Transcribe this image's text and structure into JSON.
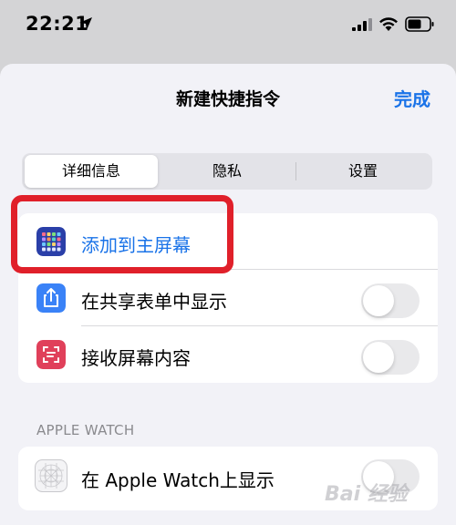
{
  "status_bar": {
    "time": "22:21",
    "icons": [
      "location-arrow-icon",
      "signal-icon",
      "wifi-icon",
      "battery-icon"
    ]
  },
  "nav": {
    "title": "新建快捷指令",
    "done_label": "完成"
  },
  "segments": [
    {
      "label": "详细信息",
      "selected": true
    },
    {
      "label": "隐私",
      "selected": false
    },
    {
      "label": "设置",
      "selected": false
    }
  ],
  "details_group": {
    "rows": [
      {
        "label": "添加到主屏幕",
        "icon": "home-screen-grid-icon",
        "has_toggle": false,
        "highlighted": true
      },
      {
        "label": "在共享表单中显示",
        "icon": "share-icon",
        "has_toggle": true,
        "toggle_on": false
      },
      {
        "label": "接收屏幕内容",
        "icon": "screen-capture-icon",
        "has_toggle": true,
        "toggle_on": false
      }
    ]
  },
  "watch_section": {
    "header": "APPLE WATCH",
    "row": {
      "label": "在 Apple Watch上显示",
      "icon": "apple-watch-grid-icon",
      "has_toggle": true,
      "toggle_on": false
    }
  },
  "colors": {
    "accent": "#1a73e8",
    "highlight_border": "#e0202a",
    "share_icon_bg": "#3a82f7",
    "screen_icon_bg": "#e0405a",
    "home_icon_bg": "#2a3fa8"
  },
  "watermark": "Bai 经验"
}
